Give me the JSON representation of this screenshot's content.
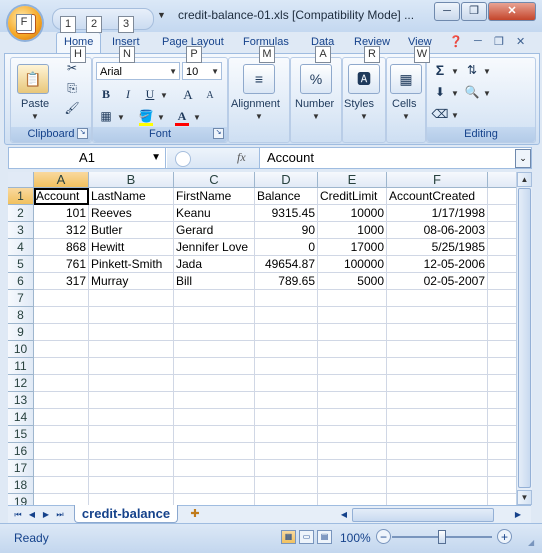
{
  "window": {
    "title": "credit-balance-01.xls  [Compatibility Mode] ...",
    "minimize": "─",
    "restore": "❐",
    "close": "✕"
  },
  "keytips": {
    "office": "F",
    "qat1": "1",
    "qat2": "2",
    "qat3": "3",
    "home": "H",
    "insert": "N",
    "page_layout": "P",
    "formulas": "M",
    "data": "A",
    "review": "R",
    "view": "W"
  },
  "tabs": [
    "Home",
    "Insert",
    "Page Layout",
    "Formulas",
    "Data",
    "Review",
    "View"
  ],
  "ribbon": {
    "clipboard": {
      "label": "Clipboard",
      "paste": "Paste"
    },
    "font": {
      "label": "Font",
      "name": "Arial",
      "size": "10",
      "bold": "B",
      "italic": "I",
      "underline": "U",
      "grow": "A",
      "shrink": "A",
      "font_color": "A"
    },
    "alignment": {
      "label": "Alignment"
    },
    "number": {
      "label": "Number",
      "icon_text": "%"
    },
    "styles": {
      "label": "Styles"
    },
    "cells": {
      "label": "Cells"
    },
    "editing": {
      "label": "Editing",
      "sum": "Σ"
    }
  },
  "formula_bar": {
    "name_box": "A1",
    "fx": "fx",
    "content": "Account"
  },
  "columns": [
    "A",
    "B",
    "C",
    "D",
    "E",
    "F"
  ],
  "rows": [
    "1",
    "2",
    "3",
    "4",
    "5",
    "6",
    "7",
    "8",
    "9",
    "10",
    "11",
    "12",
    "13",
    "14",
    "15",
    "16",
    "17",
    "18",
    "19"
  ],
  "sheet": {
    "headers": [
      "Account",
      "LastName",
      "FirstName",
      "Balance",
      "CreditLimit",
      "AccountCreated"
    ],
    "data": [
      [
        "101",
        "Reeves",
        "Keanu",
        "9315.45",
        "10000",
        "1/17/1998"
      ],
      [
        "312",
        "Butler",
        "Gerard",
        "90",
        "1000",
        "08-06-2003"
      ],
      [
        "868",
        "Hewitt",
        "Jennifer Love",
        "0",
        "17000",
        "5/25/1985"
      ],
      [
        "761",
        "Pinkett-Smith",
        "Jada",
        "49654.87",
        "100000",
        "12-05-2006"
      ],
      [
        "317",
        "Murray",
        "Bill",
        "789.65",
        "5000",
        "02-05-2007"
      ]
    ]
  },
  "sheet_tabs": {
    "active": "credit-balance"
  },
  "status": {
    "text": "Ready",
    "zoom": "100%",
    "zoom_value": 100
  },
  "colors": {
    "ribbon_text": "#15428b",
    "selected_header": "#f1c15f",
    "grid_line": "#d0d7e5"
  }
}
